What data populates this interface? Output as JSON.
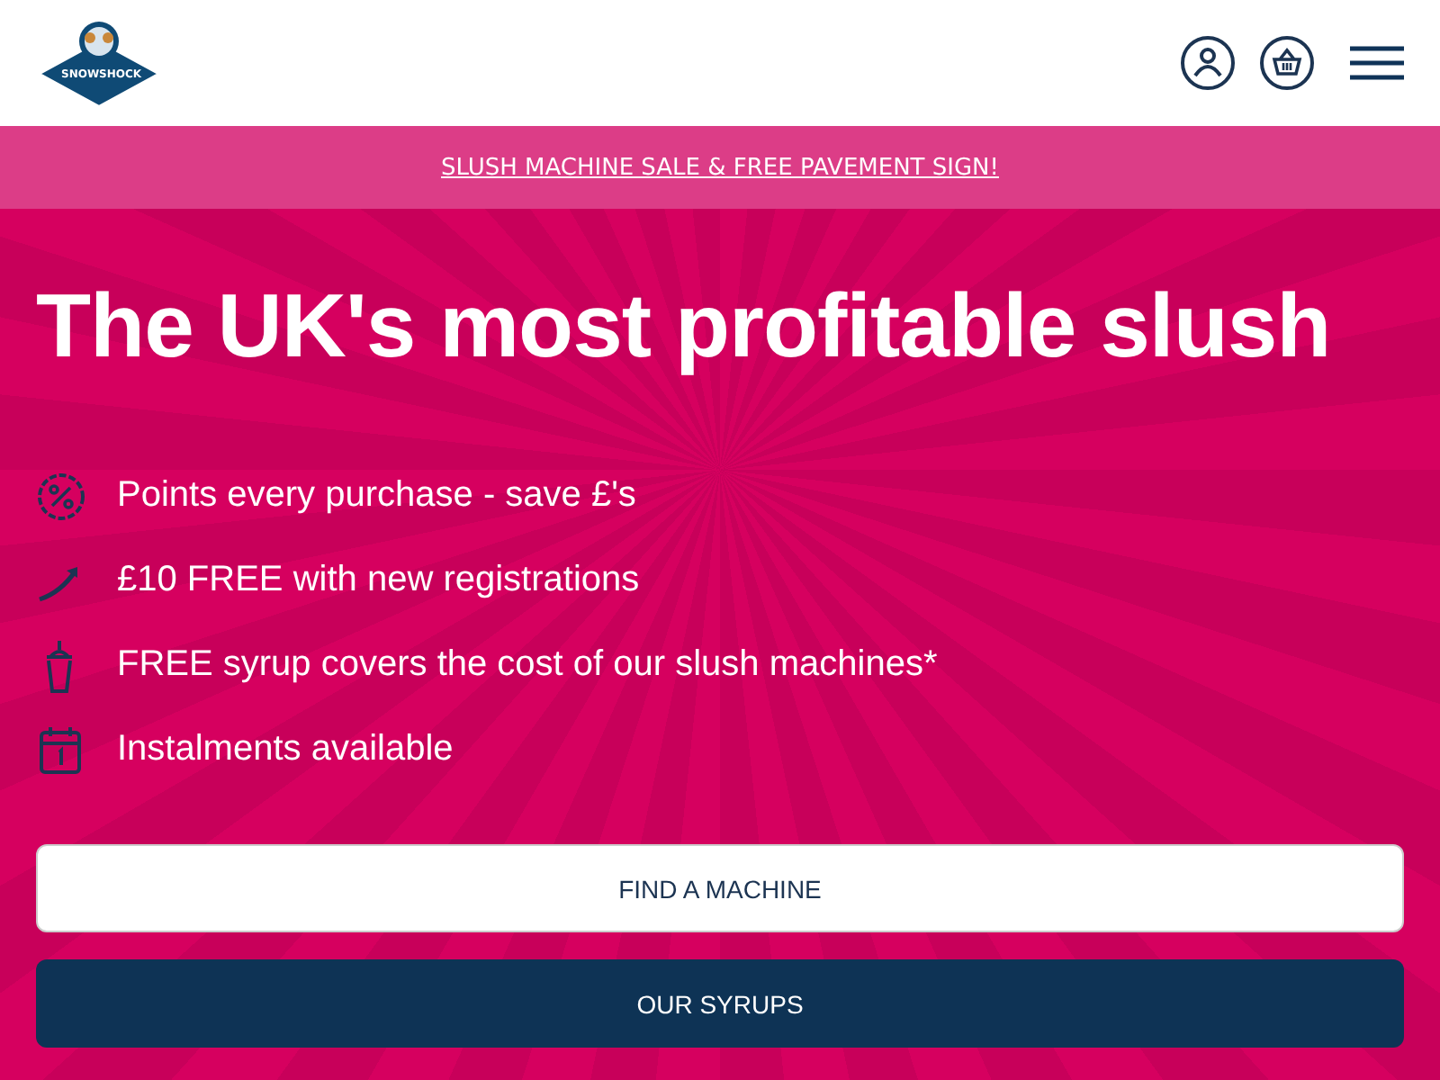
{
  "header": {
    "logo_text": "SNOWSHOCK"
  },
  "banner": {
    "link": "SLUSH MACHINE SALE & FREE PAVEMENT SIGN!"
  },
  "hero": {
    "title": "The UK's most profitable slush",
    "features": [
      {
        "kind": "percent",
        "text": "Points every purchase - save £'s"
      },
      {
        "kind": "arrow",
        "text": "£10 FREE with new registrations"
      },
      {
        "kind": "cup",
        "text": "FREE syrup covers the cost of our slush machines*"
      },
      {
        "kind": "calendar",
        "text": "Instalments available"
      }
    ],
    "buttons": [
      {
        "kind": "outline",
        "label": "FIND A MACHINE"
      },
      {
        "kind": "solid",
        "label": "OUR SYRUPS"
      }
    ]
  }
}
